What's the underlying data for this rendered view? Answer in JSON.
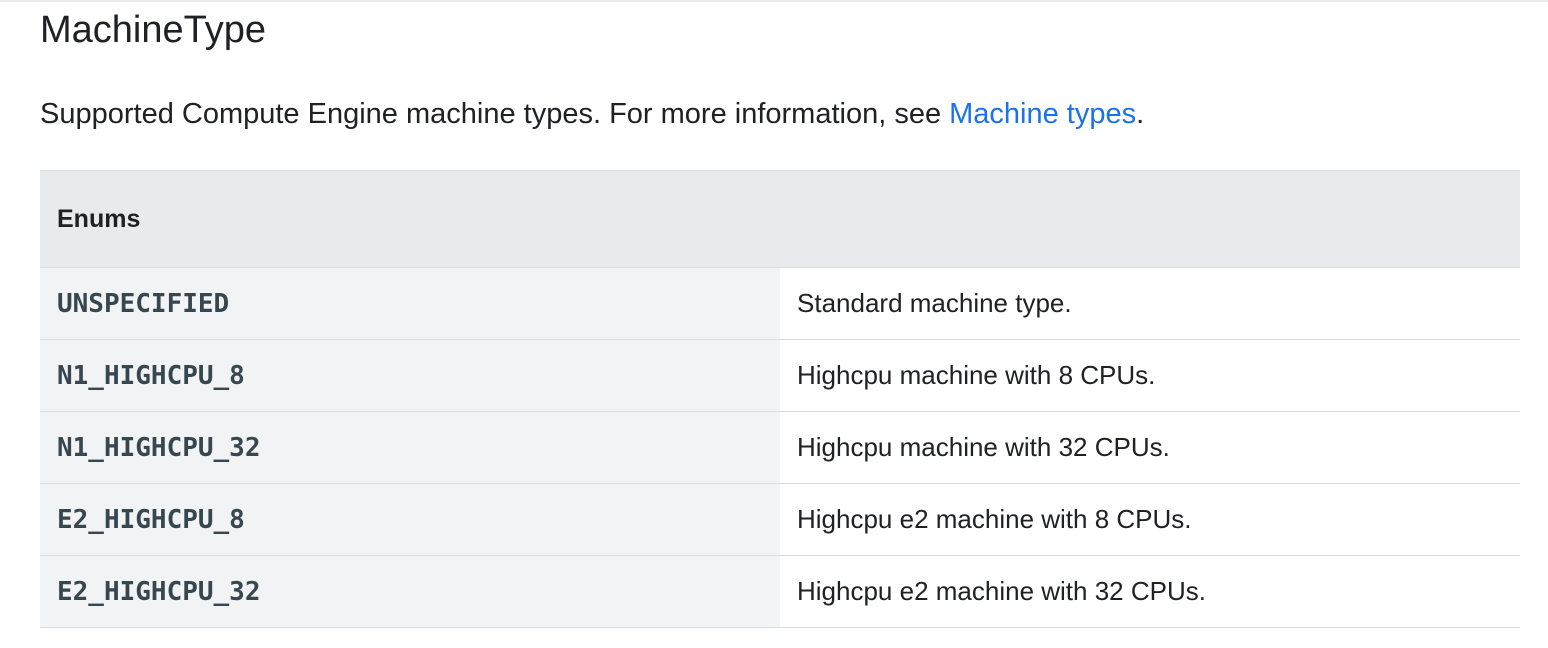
{
  "heading": {
    "title": "MachineType"
  },
  "description": {
    "text_before_link": "Supported Compute Engine machine types. For more information, see ",
    "link_text": "Machine types",
    "text_after_link": "."
  },
  "enum_table": {
    "header": "Enums",
    "rows": [
      {
        "name": "UNSPECIFIED",
        "description": "Standard machine type."
      },
      {
        "name": "N1_HIGHCPU_8",
        "description": "Highcpu machine with 8 CPUs."
      },
      {
        "name": "N1_HIGHCPU_32",
        "description": "Highcpu machine with 32 CPUs."
      },
      {
        "name": "E2_HIGHCPU_8",
        "description": "Highcpu e2 machine with 8 CPUs."
      },
      {
        "name": "E2_HIGHCPU_32",
        "description": "Highcpu e2 machine with 32 CPUs."
      }
    ]
  },
  "colors": {
    "link": "#1a73e8",
    "header_background": "#e8eaed",
    "code_cell_background": "#f1f3f4",
    "code_text": "#37474f",
    "body_text": "#202124",
    "border": "#dadce0"
  }
}
